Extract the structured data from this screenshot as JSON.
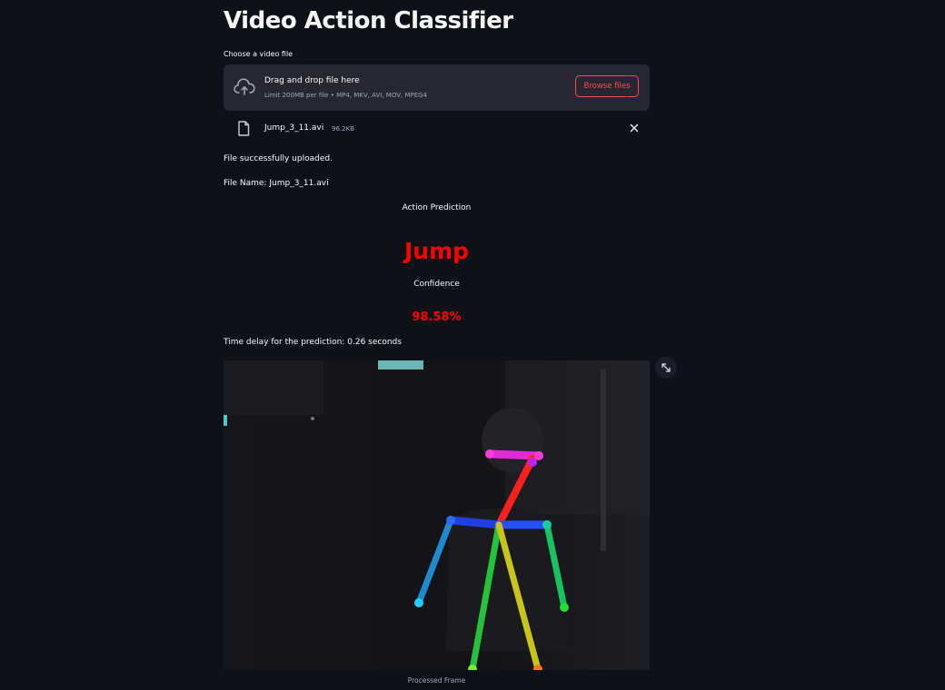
{
  "app": {
    "title": "Video Action Classifier"
  },
  "uploader": {
    "label": "Choose a video file",
    "drop_title": "Drag and drop file here",
    "drop_limit": "Limit 200MB per file • MP4, MKV, AVI, MOV, MPEG4",
    "browse_label": "Browse files",
    "icon": "cloud-upload-icon"
  },
  "uploaded_file": {
    "name": "Jump_3_11.avi",
    "size": "96.2KB",
    "icon": "file-icon",
    "remove_icon": "close-icon"
  },
  "status": {
    "message": "File successfully uploaded.",
    "file_name_line": "File Name: Jump_3_11.avi"
  },
  "prediction": {
    "label": "Action Prediction",
    "value": "Jump",
    "confidence_label": "Confidence",
    "confidence_value": "98.58%",
    "delay_text": "Time delay for the prediction: 0.26 seconds"
  },
  "frame": {
    "caption": "Processed Frame",
    "expand_icon": "expand-icon"
  },
  "colors": {
    "background": "#0e1117",
    "surface": "#262730",
    "accent": "#ff4b4b",
    "prediction": "#ff0000",
    "muted_text": "#a3a8b8"
  }
}
